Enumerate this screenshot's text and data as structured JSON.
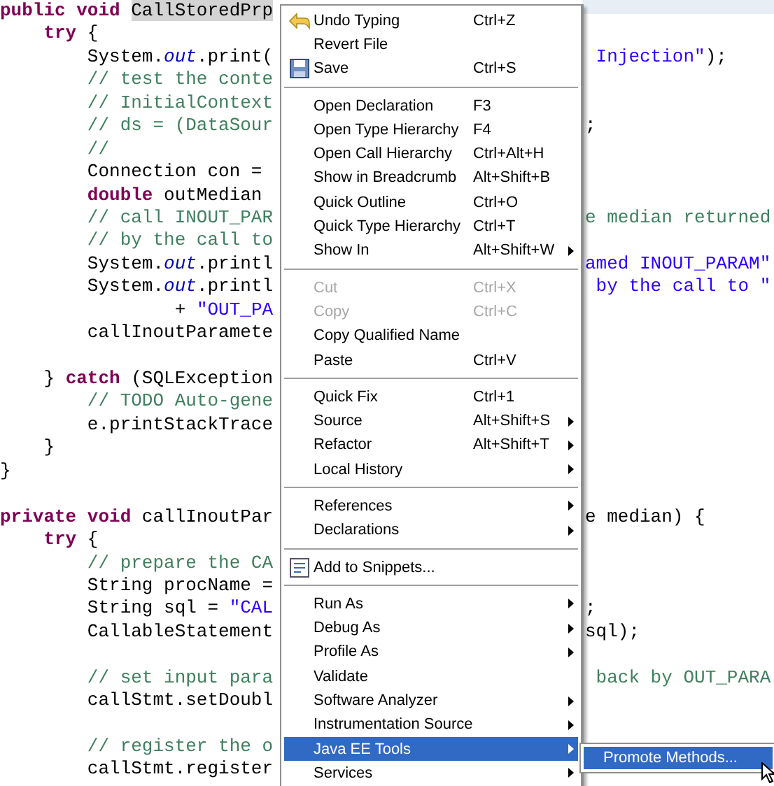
{
  "editor": {
    "lines": [
      {
        "kind": "code",
        "left": [
          {
            "kind": "kw",
            "s": "public void "
          },
          {
            "kind": "hl",
            "s": "CallStoredPrp"
          }
        ]
      },
      {
        "kind": "code",
        "left": [
          {
            "kind": "kw",
            "s": "    try"
          },
          {
            "kind": "plain",
            "s": " {"
          }
        ]
      },
      {
        "kind": "code",
        "left": [
          {
            "kind": "plain",
            "s": "        System."
          },
          {
            "kind": "field",
            "s": "out"
          },
          {
            "kind": "plain",
            "s": ".print("
          }
        ],
        "right": [
          {
            "kind": "string",
            "s": " Injection\""
          },
          {
            "kind": "plain",
            "s": ");"
          }
        ]
      },
      {
        "kind": "code",
        "left": [
          {
            "kind": "comment",
            "s": "        // test the conte"
          }
        ]
      },
      {
        "kind": "code",
        "left": [
          {
            "kind": "comment",
            "s": "        // InitialContext"
          }
        ]
      },
      {
        "kind": "code",
        "left": [
          {
            "kind": "comment",
            "s": "        // ds = (DataSour"
          }
        ],
        "right": [
          {
            "kind": "plain",
            "s": ";"
          }
        ]
      },
      {
        "kind": "code",
        "left": [
          {
            "kind": "comment",
            "s": "        //"
          }
        ]
      },
      {
        "kind": "code",
        "left": [
          {
            "kind": "plain",
            "s": "        Connection con = "
          }
        ]
      },
      {
        "kind": "code",
        "left": [
          {
            "kind": "kw",
            "s": "        double"
          },
          {
            "kind": "plain",
            "s": " outMedian "
          }
        ]
      },
      {
        "kind": "code",
        "left": [
          {
            "kind": "comment",
            "s": "        // call INOUT_PAR"
          }
        ],
        "right": [
          {
            "kind": "comment",
            "s": "e median returned"
          }
        ]
      },
      {
        "kind": "code",
        "left": [
          {
            "kind": "comment",
            "s": "        // by the call to"
          }
        ]
      },
      {
        "kind": "code",
        "left": [
          {
            "kind": "plain",
            "s": "        System."
          },
          {
            "kind": "field",
            "s": "out"
          },
          {
            "kind": "plain",
            "s": ".printl"
          }
        ],
        "right": [
          {
            "kind": "string",
            "s": "amed INOUT_PARAM\""
          }
        ]
      },
      {
        "kind": "code",
        "left": [
          {
            "kind": "plain",
            "s": "        System."
          },
          {
            "kind": "field",
            "s": "out"
          },
          {
            "kind": "plain",
            "s": ".printl"
          }
        ],
        "right": [
          {
            "kind": "string",
            "s": " by the call to \""
          }
        ]
      },
      {
        "kind": "code",
        "left": [
          {
            "kind": "plain",
            "s": "                + "
          },
          {
            "kind": "string",
            "s": "\"OUT_PA"
          }
        ]
      },
      {
        "kind": "code",
        "left": [
          {
            "kind": "plain",
            "s": "        callInoutParamete"
          }
        ]
      },
      {
        "kind": "blank"
      },
      {
        "kind": "code",
        "left": [
          {
            "kind": "plain",
            "s": "    } "
          },
          {
            "kind": "kw",
            "s": "catch"
          },
          {
            "kind": "plain",
            "s": " (SQLException"
          }
        ]
      },
      {
        "kind": "code",
        "left": [
          {
            "kind": "comment",
            "s": "        // TODO Auto-gene"
          }
        ]
      },
      {
        "kind": "code",
        "left": [
          {
            "kind": "plain",
            "s": "        e.printStackTrace"
          }
        ]
      },
      {
        "kind": "code",
        "left": [
          {
            "kind": "plain",
            "s": "    }"
          }
        ]
      },
      {
        "kind": "code",
        "left": [
          {
            "kind": "plain",
            "s": "}"
          }
        ]
      },
      {
        "kind": "blank"
      },
      {
        "kind": "code",
        "left": [
          {
            "kind": "kw",
            "s": "private void"
          },
          {
            "kind": "plain",
            "s": " callInoutPar"
          }
        ],
        "right": [
          {
            "kind": "plain",
            "s": "e median) {"
          }
        ]
      },
      {
        "kind": "code",
        "left": [
          {
            "kind": "kw",
            "s": "    try"
          },
          {
            "kind": "plain",
            "s": " {"
          }
        ]
      },
      {
        "kind": "code",
        "left": [
          {
            "kind": "comment",
            "s": "        // prepare the CA"
          }
        ]
      },
      {
        "kind": "code",
        "left": [
          {
            "kind": "plain",
            "s": "        String procName = "
          }
        ]
      },
      {
        "kind": "code",
        "left": [
          {
            "kind": "plain",
            "s": "        String sql = "
          },
          {
            "kind": "string",
            "s": "\"CAL"
          }
        ],
        "right": [
          {
            "kind": "plain",
            "s": ";"
          }
        ]
      },
      {
        "kind": "code",
        "left": [
          {
            "kind": "plain",
            "s": "        CallableStatement"
          }
        ],
        "right": [
          {
            "kind": "plain",
            "s": "sql);"
          }
        ]
      },
      {
        "kind": "blank"
      },
      {
        "kind": "code",
        "left": [
          {
            "kind": "comment",
            "s": "        // set input para"
          }
        ],
        "right": [
          {
            "kind": "comment",
            "s": " back by OUT_PARA"
          }
        ]
      },
      {
        "kind": "code",
        "left": [
          {
            "kind": "plain",
            "s": "        callStmt.setDoubl"
          }
        ]
      },
      {
        "kind": "blank"
      },
      {
        "kind": "code",
        "left": [
          {
            "kind": "comment",
            "s": "        // register the o"
          }
        ]
      },
      {
        "kind": "code",
        "left": [
          {
            "kind": "plain",
            "s": "        callStmt.register"
          }
        ]
      }
    ]
  },
  "context_menu": {
    "items": [
      {
        "kind": "undo",
        "label": "Undo Typing",
        "shortcut": "Ctrl+Z",
        "submenu": false,
        "disabled": false,
        "selected": false
      },
      {
        "kind": "item",
        "label": "Revert File",
        "submenu": false,
        "disabled": false,
        "selected": false
      },
      {
        "kind": "save",
        "label": "Save",
        "shortcut": "Ctrl+S",
        "submenu": false,
        "disabled": false,
        "selected": false
      },
      {
        "kind": "separator"
      },
      {
        "kind": "item",
        "label": "Open Declaration",
        "shortcut": "F3",
        "submenu": false,
        "disabled": false,
        "selected": false
      },
      {
        "kind": "item",
        "label": "Open Type Hierarchy",
        "shortcut": "F4",
        "submenu": false,
        "disabled": false,
        "selected": false
      },
      {
        "kind": "item",
        "label": "Open Call Hierarchy",
        "shortcut": "Ctrl+Alt+H",
        "submenu": false,
        "disabled": false,
        "selected": false
      },
      {
        "kind": "item",
        "label": "Show in Breadcrumb",
        "shortcut": "Alt+Shift+B",
        "submenu": false,
        "disabled": false,
        "selected": false
      },
      {
        "kind": "item",
        "label": "Quick Outline",
        "shortcut": "Ctrl+O",
        "submenu": false,
        "disabled": false,
        "selected": false
      },
      {
        "kind": "item",
        "label": "Quick Type Hierarchy",
        "shortcut": "Ctrl+T",
        "submenu": false,
        "disabled": false,
        "selected": false
      },
      {
        "kind": "item",
        "label": "Show In",
        "shortcut": "Alt+Shift+W",
        "submenu": true,
        "disabled": false,
        "selected": false
      },
      {
        "kind": "separator"
      },
      {
        "kind": "item",
        "label": "Cut",
        "shortcut": "Ctrl+X",
        "submenu": false,
        "disabled": true,
        "selected": false
      },
      {
        "kind": "item",
        "label": "Copy",
        "shortcut": "Ctrl+C",
        "submenu": false,
        "disabled": true,
        "selected": false
      },
      {
        "kind": "item",
        "label": "Copy Qualified Name",
        "submenu": false,
        "disabled": false,
        "selected": false
      },
      {
        "kind": "item",
        "label": "Paste",
        "shortcut": "Ctrl+V",
        "submenu": false,
        "disabled": false,
        "selected": false
      },
      {
        "kind": "separator"
      },
      {
        "kind": "item",
        "label": "Quick Fix",
        "shortcut": "Ctrl+1",
        "submenu": false,
        "disabled": false,
        "selected": false
      },
      {
        "kind": "item",
        "label": "Source",
        "shortcut": "Alt+Shift+S",
        "submenu": true,
        "disabled": false,
        "selected": false
      },
      {
        "kind": "item",
        "label": "Refactor",
        "shortcut": "Alt+Shift+T",
        "submenu": true,
        "disabled": false,
        "selected": false
      },
      {
        "kind": "item",
        "label": "Local History",
        "submenu": true,
        "disabled": false,
        "selected": false
      },
      {
        "kind": "separator"
      },
      {
        "kind": "item",
        "label": "References",
        "submenu": true,
        "disabled": false,
        "selected": false
      },
      {
        "kind": "item",
        "label": "Declarations",
        "submenu": true,
        "disabled": false,
        "selected": false
      },
      {
        "kind": "separator"
      },
      {
        "kind": "snippet",
        "label": "Add to Snippets...",
        "submenu": false,
        "disabled": false,
        "selected": false
      },
      {
        "kind": "separator"
      },
      {
        "kind": "item",
        "label": "Run As",
        "submenu": true,
        "disabled": false,
        "selected": false
      },
      {
        "kind": "item",
        "label": "Debug As",
        "submenu": true,
        "disabled": false,
        "selected": false
      },
      {
        "kind": "item",
        "label": "Profile As",
        "submenu": true,
        "disabled": false,
        "selected": false
      },
      {
        "kind": "item",
        "label": "Validate",
        "submenu": false,
        "disabled": false,
        "selected": false
      },
      {
        "kind": "item",
        "label": "Software Analyzer",
        "submenu": true,
        "disabled": false,
        "selected": false
      },
      {
        "kind": "item",
        "label": "Instrumentation Source",
        "submenu": true,
        "disabled": false,
        "selected": false
      },
      {
        "kind": "item",
        "label": "Java EE Tools",
        "submenu": true,
        "disabled": false,
        "selected": true
      },
      {
        "kind": "item",
        "label": "Services",
        "submenu": true,
        "disabled": false,
        "selected": false
      }
    ]
  },
  "submenu": {
    "items": [
      {
        "label": "Promote Methods...",
        "selected": true
      }
    ]
  }
}
